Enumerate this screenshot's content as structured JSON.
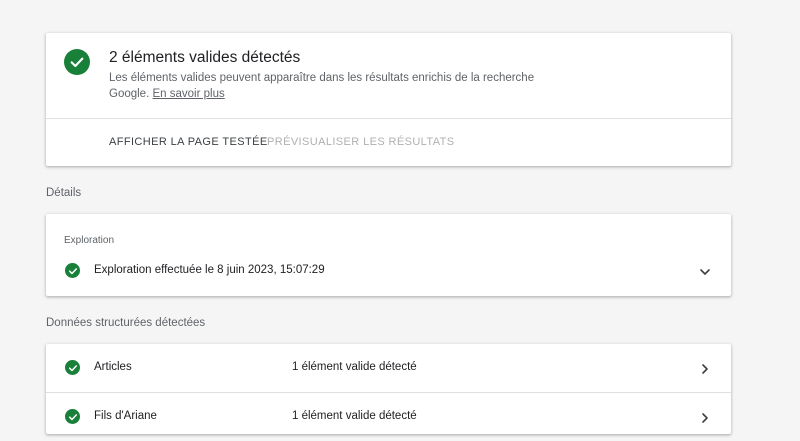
{
  "summary": {
    "title": "2 éléments valides détectés",
    "description": "Les éléments valides peuvent apparaître dans les résultats enrichis de la recherche Google.",
    "learn_more": "En savoir plus",
    "actions": {
      "view_page": "AFFICHER LA PAGE TESTÉE",
      "preview": "PRÉVISUALISER LES RÉSULTATS"
    }
  },
  "details": {
    "label": "Détails",
    "crawl": {
      "header": "Exploration",
      "status": "Exploration effectuée le 8 juin 2023, 15:07:29"
    }
  },
  "structured_data": {
    "label": "Données structurées détectées",
    "rows": [
      {
        "name": "Articles",
        "status": "1 élément valide détecté"
      },
      {
        "name": "Fils d'Ariane",
        "status": "1 élément valide détecté"
      }
    ]
  },
  "colors": {
    "success_green": "#188038",
    "background": "#f5f5f5",
    "disabled_text": "#b0b0b0"
  },
  "icons": {
    "valid": "check-circle-icon",
    "expand": "chevron-down-icon",
    "open": "chevron-right-icon"
  }
}
